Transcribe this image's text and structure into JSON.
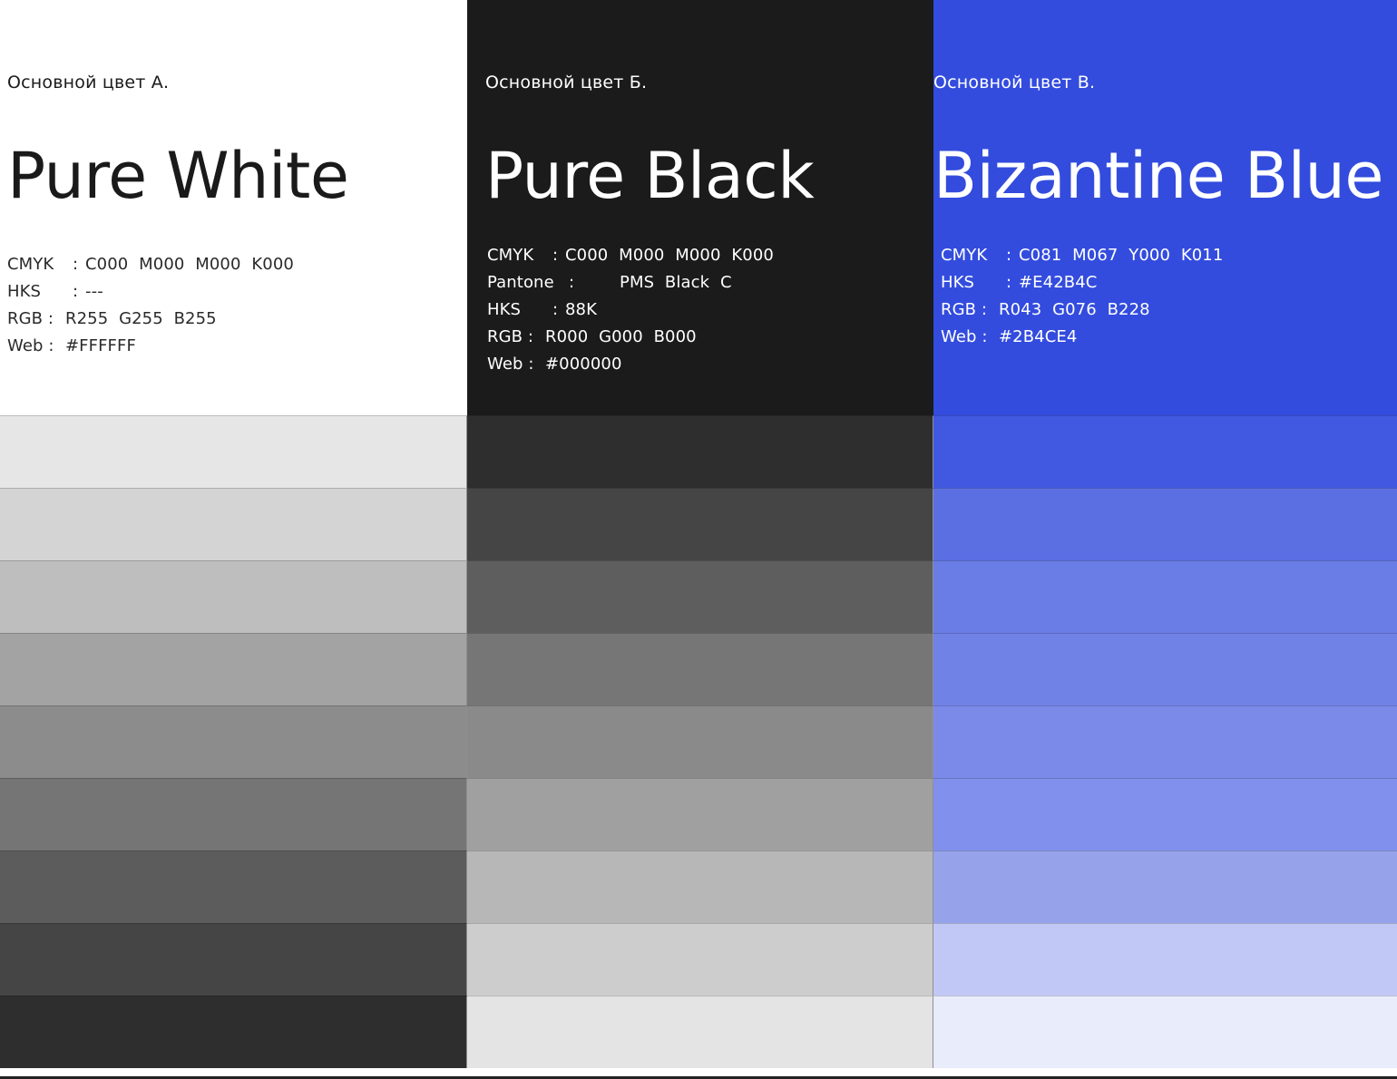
{
  "columns": [
    {
      "subtitle": "Основной цвет А.",
      "title": "Pure White",
      "base_color": "#FFFFFF",
      "specs": [
        {
          "label": "CMYK",
          "sep": ":",
          "value": "C000 M000 M000 K000"
        },
        {
          "label": "HKS",
          "sep": ":",
          "value": "---"
        },
        {
          "label": "RGB :",
          "sep": "",
          "value": "R255 G255 B255"
        },
        {
          "label": "Web :",
          "sep": "",
          "value": "#FFFFFF"
        }
      ],
      "swatches": [
        "#e6e6e6",
        "#d4d4d4",
        "#bebebe",
        "#a3a3a3",
        "#8c8c8c",
        "#757575",
        "#5c5c5c",
        "#454545",
        "#2e2e2e"
      ]
    },
    {
      "subtitle": "Основной цвет Б.",
      "title": "Pure Black",
      "base_color": "#1B1B1B",
      "specs": [
        {
          "label": "CMYK",
          "sep": ":",
          "value": "C000 M000 M000 K000"
        },
        {
          "label": "Pantone",
          "sep": ":",
          "value": "PMS Black C"
        },
        {
          "label": "HKS",
          "sep": ":",
          "value": "88K"
        },
        {
          "label": "RGB :",
          "sep": "",
          "value": "R000 G000 B000"
        },
        {
          "label": "Web :",
          "sep": "",
          "value": "#000000"
        }
      ],
      "swatches": [
        "#2e2e2e",
        "#454545",
        "#5e5e5e",
        "#767676",
        "#8a8a8a",
        "#a0a0a0",
        "#b7b7b7",
        "#cdcdcd",
        "#e4e4e4"
      ]
    },
    {
      "subtitle": "Основной цвет В.",
      "title": "Bizantine Blue",
      "base_color": "#334CDE",
      "specs": [
        {
          "label": "CMYK",
          "sep": ":",
          "value": "C081 M067 Y000 K011"
        },
        {
          "label": "HKS",
          "sep": ":",
          "value": "#E42B4C"
        },
        {
          "label": "RGB :",
          "sep": "",
          "value": "R043 G076 B228"
        },
        {
          "label": "Web :",
          "sep": "",
          "value": "#2B4CE4"
        }
      ],
      "swatches": [
        "#4158e0",
        "#5b6fe3",
        "#6a7ce5",
        "#7182e6",
        "#7b8ae9",
        "#8090ec",
        "#96a3ea",
        "#c2c8f5",
        "#e8ecfb"
      ]
    }
  ]
}
